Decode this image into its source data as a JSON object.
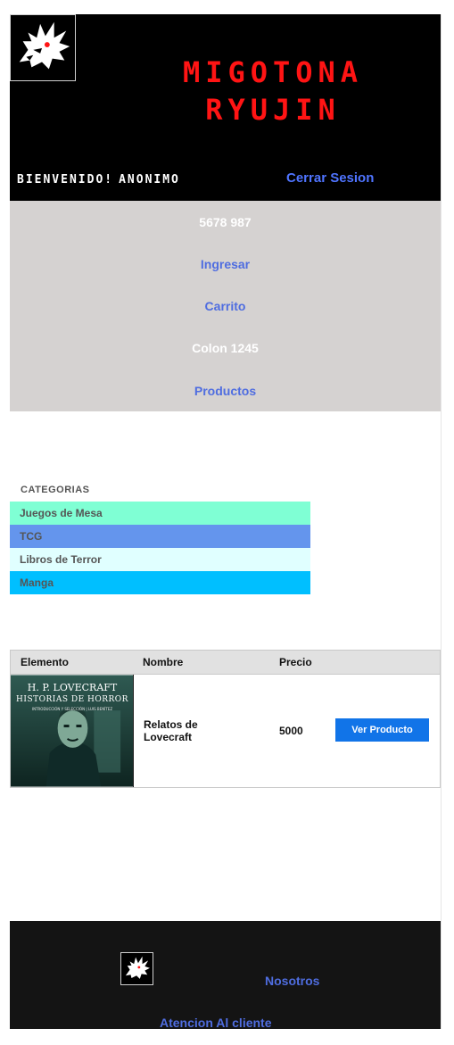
{
  "header": {
    "brand_line1": "MIGOTONA",
    "brand_line2": "RYUJIN",
    "welcome_label": "BIENVENIDO!",
    "user_name": "ANONIMO",
    "logout": "Cerrar Sesion"
  },
  "nav": {
    "items": [
      {
        "label": "5678 987",
        "style": "text"
      },
      {
        "label": "Ingresar",
        "style": "link"
      },
      {
        "label": "Carrito",
        "style": "link"
      },
      {
        "label": "Colon 1245",
        "style": "text"
      },
      {
        "label": "Productos",
        "style": "link"
      }
    ]
  },
  "categories": {
    "title": "CATEGORIAS",
    "items": [
      {
        "label": "Juegos de Mesa",
        "bg": "#7fffd4",
        "color": "#555555"
      },
      {
        "label": "TCG",
        "bg": "#6495ed",
        "color": "#555555"
      },
      {
        "label": "Libros de Terror",
        "bg": "#e0ffff",
        "color": "#555555"
      },
      {
        "label": "Manga",
        "bg": "#00bfff",
        "color": "#555555"
      }
    ]
  },
  "table": {
    "headers": [
      "Elemento",
      "Nombre",
      "Precio"
    ],
    "rows": [
      {
        "cover_title": "H. P. LOVECRAFT",
        "cover_subtitle": "HISTORIAS DE HORROR",
        "cover_small": "INTRODUCCIÓN Y SELECCIÓN | LUIS BENÍTEZ",
        "name_line1": "Relatos de",
        "name_line2": "Lovecraft",
        "price": "5000",
        "action": "Ver Producto"
      }
    ]
  },
  "footer": {
    "about": "Nosotros",
    "support": "Atencion Al cliente"
  },
  "colors": {
    "header_bg": "#000000",
    "brand": "#ff1414",
    "link": "#4f6de0",
    "nav_bg": "#d5d2d1",
    "button": "#1174e8",
    "footer_bg": "#141414"
  },
  "icons": {
    "logo": "dragon-head-icon"
  }
}
